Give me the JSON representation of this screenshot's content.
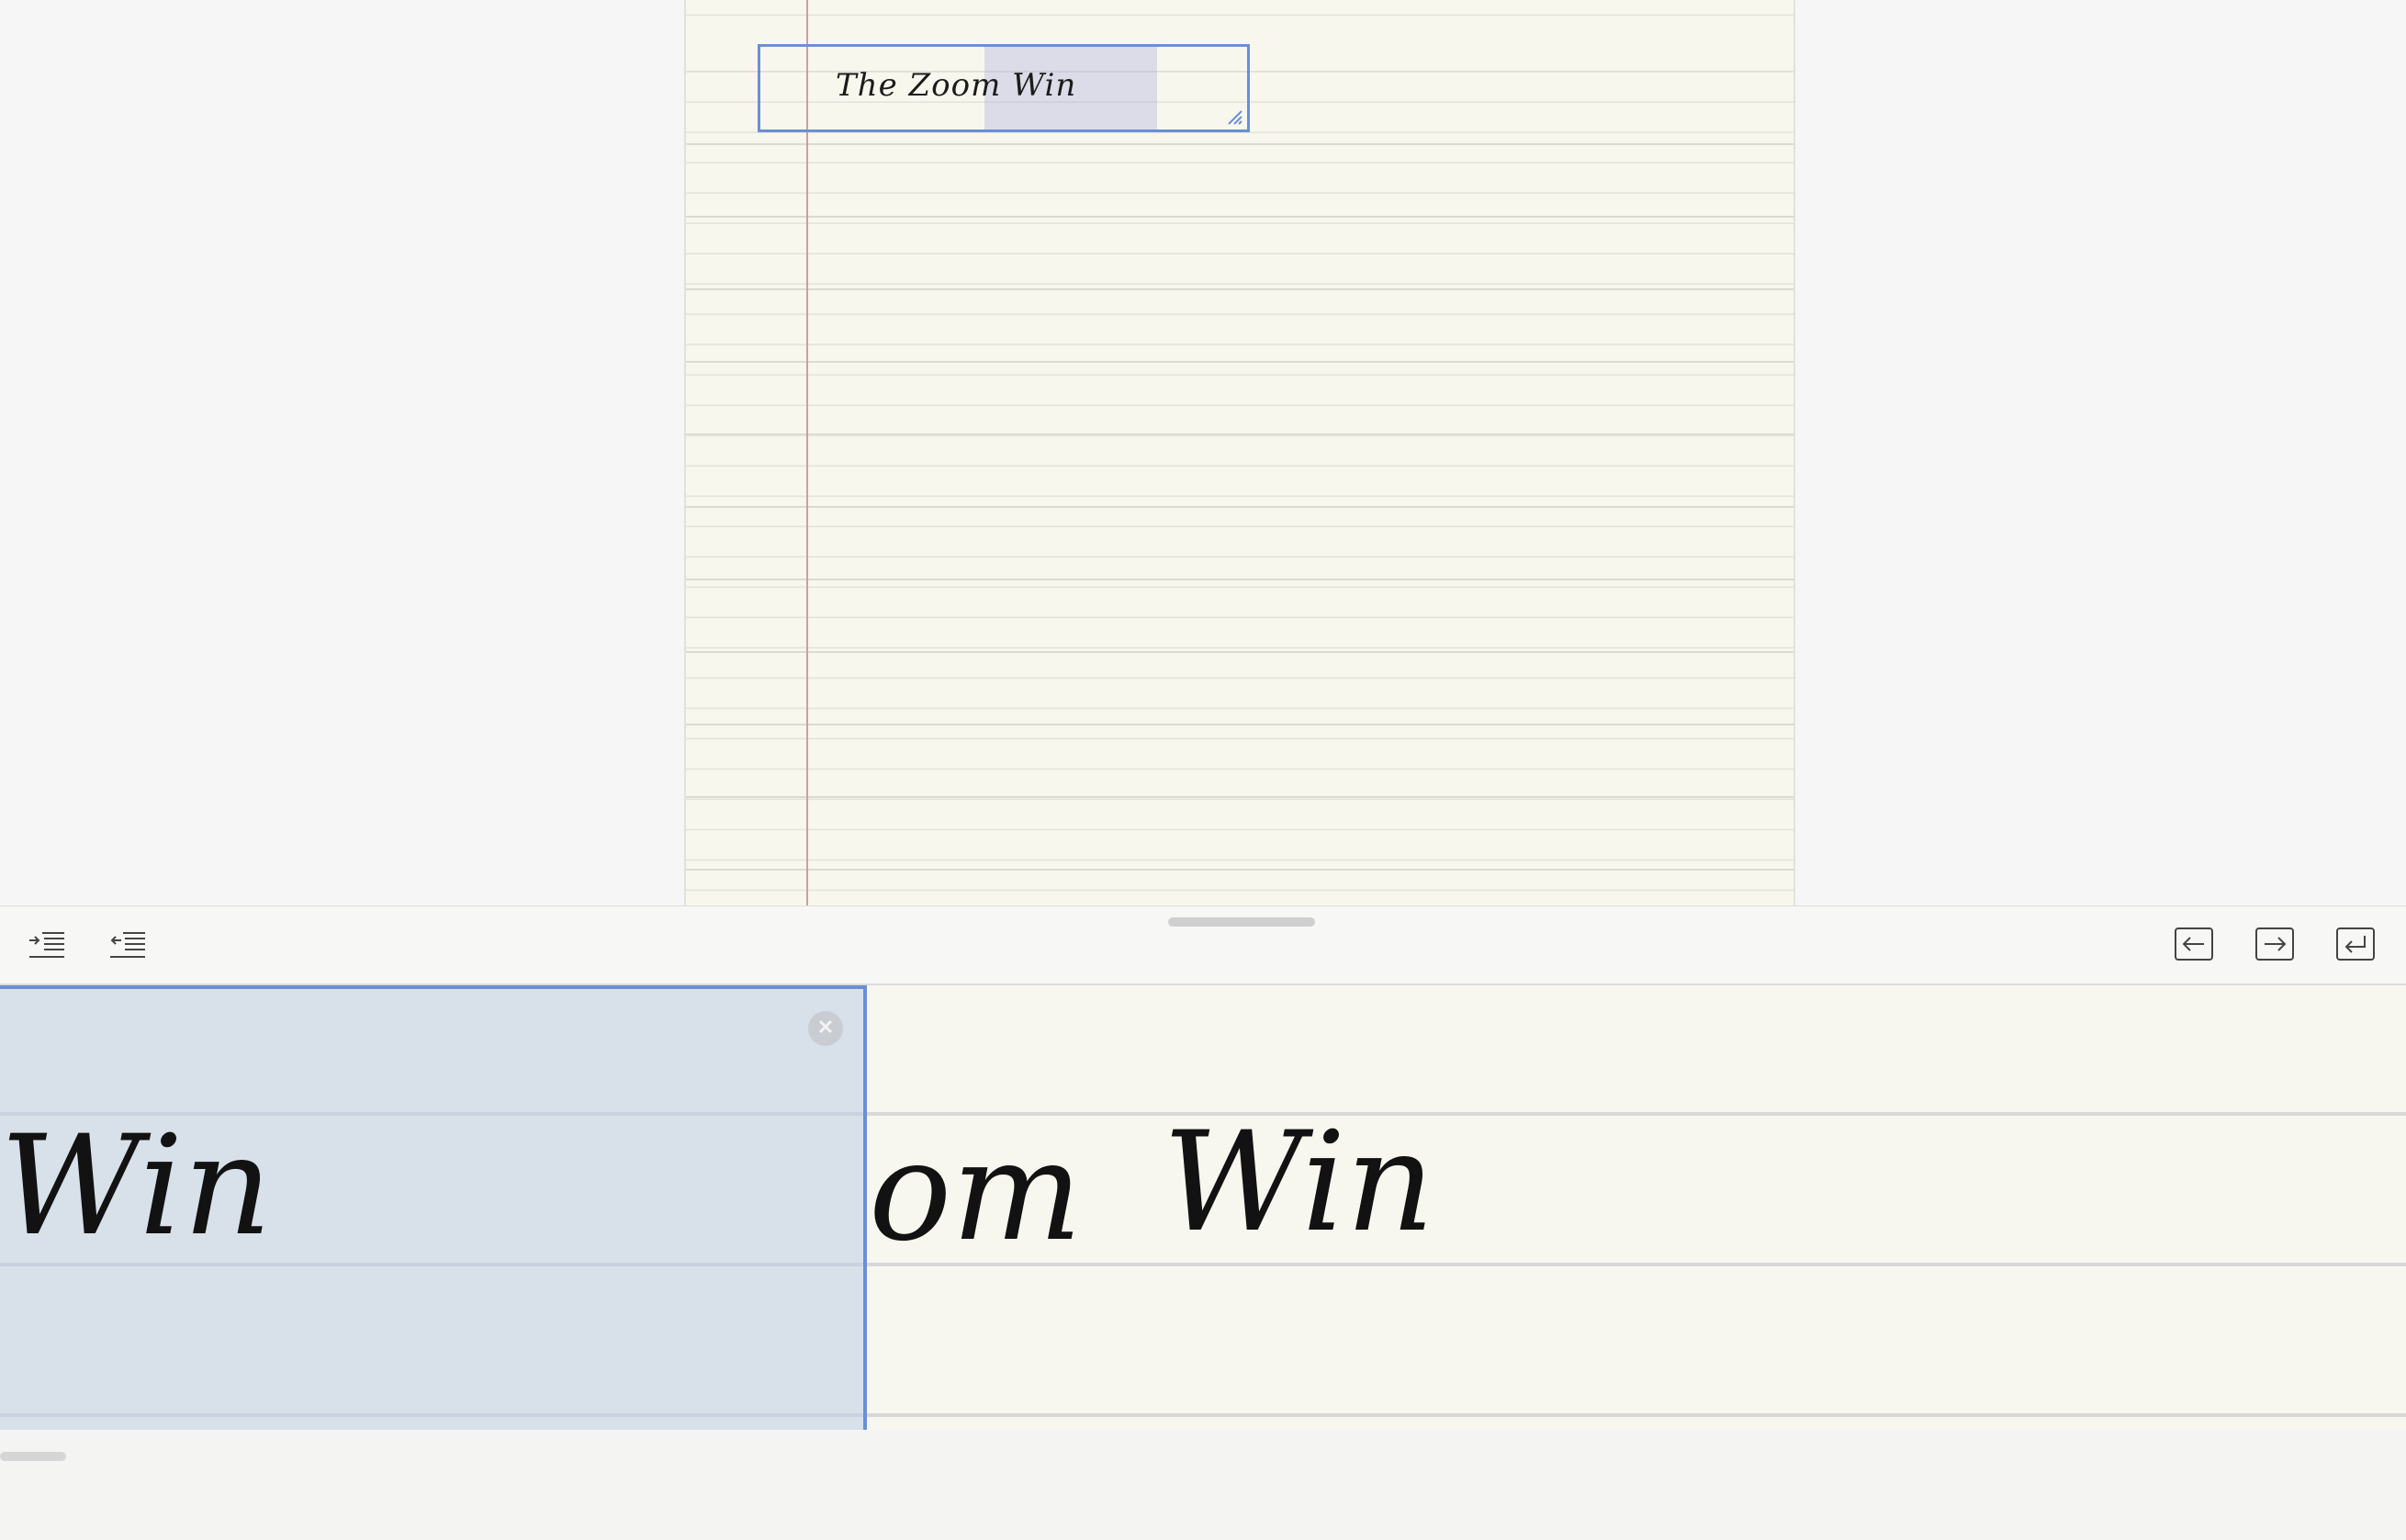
{
  "document": {
    "textbox_text": "The Zoom Win"
  },
  "toolbar": {
    "indent_icon": "indent-icon",
    "outdent_icon": "outdent-icon",
    "prev_icon": "arrow-left-icon",
    "next_icon": "arrow-right-icon",
    "newline_icon": "return-icon"
  },
  "scribble": {
    "selected_fragment": "Win",
    "strokes_left": "om",
    "strokes_right": "Win"
  },
  "colors": {
    "accent": "#6b8fd6",
    "paper": "#f8f7ee",
    "margin_line": "#c9a0a0"
  }
}
